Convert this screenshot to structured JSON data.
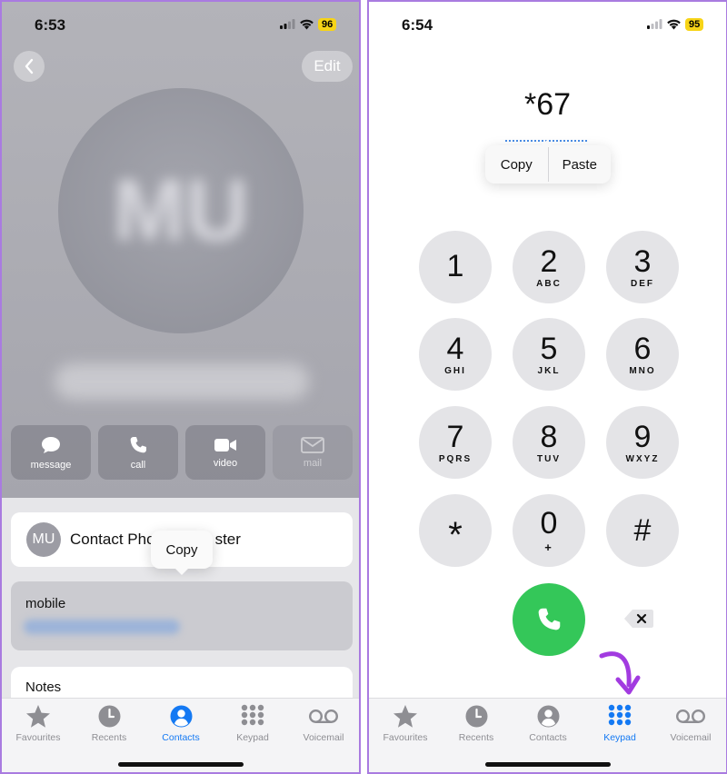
{
  "left": {
    "status": {
      "time": "6:53",
      "battery": "96"
    },
    "header": {
      "edit_label": "Edit"
    },
    "avatar": {
      "initials": "MU"
    },
    "actions": [
      {
        "label": "message",
        "icon": "message-icon"
      },
      {
        "label": "call",
        "icon": "phone-icon"
      },
      {
        "label": "video",
        "icon": "video-icon"
      },
      {
        "label": "mail",
        "icon": "mail-icon"
      }
    ],
    "contact": {
      "initials": "MU",
      "name_visible": "Contact Pho",
      "name_tail": "ster"
    },
    "copy_popover": {
      "label": "Copy"
    },
    "phone_field": {
      "label": "mobile"
    },
    "notes_field": {
      "label": "Notes"
    },
    "tabs": [
      {
        "label": "Favourites",
        "icon": "star-icon"
      },
      {
        "label": "Recents",
        "icon": "clock-icon"
      },
      {
        "label": "Contacts",
        "icon": "person-circle-icon",
        "active": true
      },
      {
        "label": "Keypad",
        "icon": "keypad-icon"
      },
      {
        "label": "Voicemail",
        "icon": "voicemail-icon"
      }
    ]
  },
  "right": {
    "status": {
      "time": "6:54",
      "battery": "95"
    },
    "dialed": "*67",
    "edit_menu": {
      "copy": "Copy",
      "paste": "Paste"
    },
    "keys": [
      {
        "digit": "1",
        "letters": ""
      },
      {
        "digit": "2",
        "letters": "ABC"
      },
      {
        "digit": "3",
        "letters": "DEF"
      },
      {
        "digit": "4",
        "letters": "GHI"
      },
      {
        "digit": "5",
        "letters": "JKL"
      },
      {
        "digit": "6",
        "letters": "MNO"
      },
      {
        "digit": "7",
        "letters": "PQRS"
      },
      {
        "digit": "8",
        "letters": "TUV"
      },
      {
        "digit": "9",
        "letters": "WXYZ"
      },
      {
        "digit": "*",
        "letters": ""
      },
      {
        "digit": "0",
        "letters": "+"
      },
      {
        "digit": "#",
        "letters": ""
      }
    ],
    "tabs": [
      {
        "label": "Favourites",
        "icon": "star-icon"
      },
      {
        "label": "Recents",
        "icon": "clock-icon"
      },
      {
        "label": "Contacts",
        "icon": "person-circle-icon"
      },
      {
        "label": "Keypad",
        "icon": "keypad-icon",
        "active": true
      },
      {
        "label": "Voicemail",
        "icon": "voicemail-icon"
      }
    ]
  },
  "colors": {
    "accent": "#1479f3",
    "call_green": "#34c759",
    "battery": "#f7d417",
    "annotation_arrow": "#a23be0",
    "frame": "#a97be0"
  }
}
